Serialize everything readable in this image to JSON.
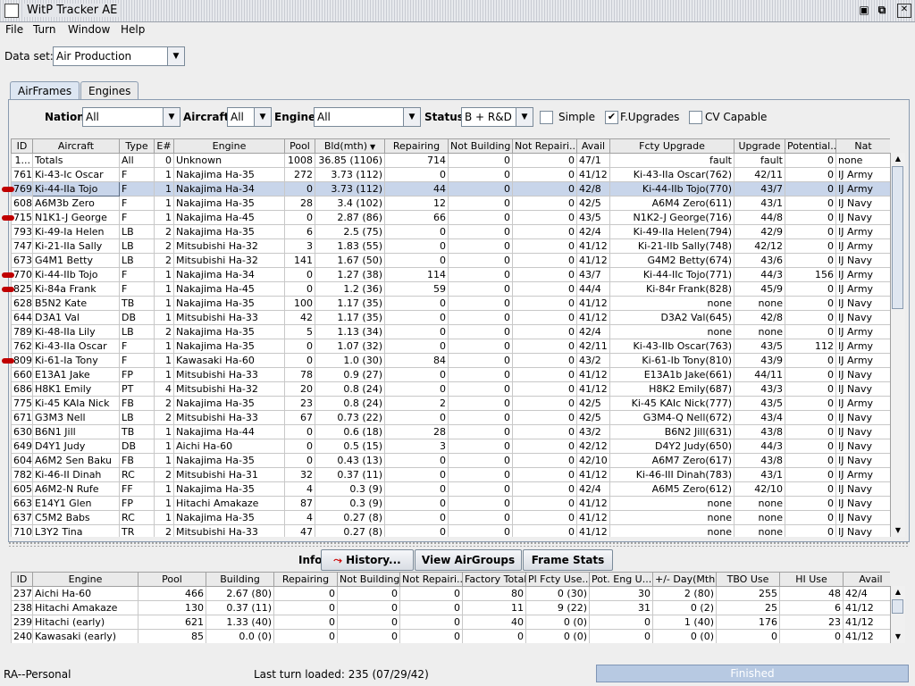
{
  "window": {
    "title": "WitP Tracker AE"
  },
  "menu": [
    "File",
    "Turn",
    "Window",
    "Help"
  ],
  "dataset": {
    "label": "Data set:",
    "value": "Air Production"
  },
  "tabs": [
    "AirFrames",
    "Engines"
  ],
  "filters": {
    "nation_label": "Nation:",
    "nation_value": "All",
    "aircraft_label": "Aircraft:",
    "aircraft_value": "All",
    "engine_label": "Engine:",
    "engine_value": "All",
    "status_label": "Status:",
    "status_value": "B + R&D",
    "simple_label": "Simple",
    "simple_checked": false,
    "fupgrades_label": "F.Upgrades",
    "fupgrades_checked": true,
    "cv_label": "CV Capable",
    "cv_checked": false
  },
  "airframes": {
    "columns": [
      "ID",
      "Aircraft",
      "Type",
      "E#",
      "Engine",
      "Pool",
      "Bld(mth)",
      "Repairing",
      "Not Building",
      "Not Repairi...",
      "Avail",
      "Fcty Upgrade",
      "Upgrade",
      "Potential...",
      "Nat"
    ],
    "sort_indicator": "▼",
    "selected_row": 2,
    "rows": [
      [
        "1...",
        "Totals",
        "All",
        "0",
        "Unknown",
        "1008",
        "36.85 (1106)",
        "714",
        "0",
        "0",
        "47/1",
        "fault",
        "fault",
        "0",
        "none"
      ],
      [
        "761",
        "Ki-43-Ic Oscar",
        "F",
        "1",
        "Nakajima Ha-35",
        "272",
        "3.73 (112)",
        "0",
        "0",
        "0",
        "41/12",
        "Ki-43-IIa Oscar(762)",
        "42/11",
        "0",
        "IJ Army"
      ],
      [
        "769",
        "Ki-44-IIa Tojo",
        "F",
        "1",
        "Nakajima Ha-34",
        "0",
        "3.73 (112)",
        "44",
        "0",
        "0",
        "42/8",
        "Ki-44-IIb Tojo(770)",
        "43/7",
        "0",
        "IJ Army"
      ],
      [
        "608",
        "A6M3b Zero",
        "F",
        "1",
        "Nakajima Ha-35",
        "28",
        "3.4 (102)",
        "12",
        "0",
        "0",
        "42/5",
        "A6M4 Zero(611)",
        "43/1",
        "0",
        "IJ Navy"
      ],
      [
        "715",
        "N1K1-J George",
        "F",
        "1",
        "Nakajima Ha-45",
        "0",
        "2.87 (86)",
        "66",
        "0",
        "0",
        "43/5",
        "N1K2-J George(716)",
        "44/8",
        "0",
        "IJ Navy"
      ],
      [
        "793",
        "Ki-49-Ia Helen",
        "LB",
        "2",
        "Nakajima Ha-35",
        "6",
        "2.5 (75)",
        "0",
        "0",
        "0",
        "42/4",
        "Ki-49-IIa Helen(794)",
        "42/9",
        "0",
        "IJ Army"
      ],
      [
        "747",
        "Ki-21-IIa Sally",
        "LB",
        "2",
        "Mitsubishi Ha-32",
        "3",
        "1.83 (55)",
        "0",
        "0",
        "0",
        "41/12",
        "Ki-21-IIb Sally(748)",
        "42/12",
        "0",
        "IJ Army"
      ],
      [
        "673",
        "G4M1 Betty",
        "LB",
        "2",
        "Mitsubishi Ha-32",
        "141",
        "1.67 (50)",
        "0",
        "0",
        "0",
        "41/12",
        "G4M2 Betty(674)",
        "43/6",
        "0",
        "IJ Navy"
      ],
      [
        "770",
        "Ki-44-IIb Tojo",
        "F",
        "1",
        "Nakajima Ha-34",
        "0",
        "1.27 (38)",
        "114",
        "0",
        "0",
        "43/7",
        "Ki-44-IIc Tojo(771)",
        "44/3",
        "156",
        "IJ Army"
      ],
      [
        "825",
        "Ki-84a Frank",
        "F",
        "1",
        "Nakajima Ha-45",
        "0",
        "1.2 (36)",
        "59",
        "0",
        "0",
        "44/4",
        "Ki-84r Frank(828)",
        "45/9",
        "0",
        "IJ Army"
      ],
      [
        "628",
        "B5N2 Kate",
        "TB",
        "1",
        "Nakajima Ha-35",
        "100",
        "1.17 (35)",
        "0",
        "0",
        "0",
        "41/12",
        "none",
        "none",
        "0",
        "IJ Navy"
      ],
      [
        "644",
        "D3A1 Val",
        "DB",
        "1",
        "Mitsubishi Ha-33",
        "42",
        "1.17 (35)",
        "0",
        "0",
        "0",
        "41/12",
        "D3A2 Val(645)",
        "42/8",
        "0",
        "IJ Navy"
      ],
      [
        "789",
        "Ki-48-IIa Lily",
        "LB",
        "2",
        "Nakajima Ha-35",
        "5",
        "1.13 (34)",
        "0",
        "0",
        "0",
        "42/4",
        "none",
        "none",
        "0",
        "IJ Army"
      ],
      [
        "762",
        "Ki-43-IIa Oscar",
        "F",
        "1",
        "Nakajima Ha-35",
        "0",
        "1.07 (32)",
        "0",
        "0",
        "0",
        "42/11",
        "Ki-43-IIb Oscar(763)",
        "43/5",
        "112",
        "IJ Army"
      ],
      [
        "809",
        "Ki-61-Ia Tony",
        "F",
        "1",
        "Kawasaki Ha-60",
        "0",
        "1.0 (30)",
        "84",
        "0",
        "0",
        "43/2",
        "Ki-61-Ib Tony(810)",
        "43/9",
        "0",
        "IJ Army"
      ],
      [
        "660",
        "E13A1 Jake",
        "FP",
        "1",
        "Mitsubishi Ha-33",
        "78",
        "0.9 (27)",
        "0",
        "0",
        "0",
        "41/12",
        "E13A1b Jake(661)",
        "44/11",
        "0",
        "IJ Navy"
      ],
      [
        "686",
        "H8K1 Emily",
        "PT",
        "4",
        "Mitsubishi Ha-32",
        "20",
        "0.8 (24)",
        "0",
        "0",
        "0",
        "41/12",
        "H8K2 Emily(687)",
        "43/3",
        "0",
        "IJ Navy"
      ],
      [
        "775",
        "Ki-45 KAIa Nick",
        "FB",
        "2",
        "Nakajima Ha-35",
        "23",
        "0.8 (24)",
        "2",
        "0",
        "0",
        "42/5",
        "Ki-45 KAIc Nick(777)",
        "43/5",
        "0",
        "IJ Army"
      ],
      [
        "671",
        "G3M3 Nell",
        "LB",
        "2",
        "Mitsubishi Ha-33",
        "67",
        "0.73 (22)",
        "0",
        "0",
        "0",
        "42/5",
        "G3M4-Q Nell(672)",
        "43/4",
        "0",
        "IJ Navy"
      ],
      [
        "630",
        "B6N1 Jill",
        "TB",
        "1",
        "Nakajima Ha-44",
        "0",
        "0.6 (18)",
        "28",
        "0",
        "0",
        "43/2",
        "B6N2 Jill(631)",
        "43/8",
        "0",
        "IJ Navy"
      ],
      [
        "649",
        "D4Y1 Judy",
        "DB",
        "1",
        "Aichi Ha-60",
        "0",
        "0.5 (15)",
        "3",
        "0",
        "0",
        "42/12",
        "D4Y2 Judy(650)",
        "44/3",
        "0",
        "IJ Navy"
      ],
      [
        "604",
        "A6M2 Sen Baku",
        "FB",
        "1",
        "Nakajima Ha-35",
        "0",
        "0.43 (13)",
        "0",
        "0",
        "0",
        "42/10",
        "A6M7 Zero(617)",
        "43/8",
        "0",
        "IJ Navy"
      ],
      [
        "782",
        "Ki-46-II Dinah",
        "RC",
        "2",
        "Mitsubishi Ha-31",
        "32",
        "0.37 (11)",
        "0",
        "0",
        "0",
        "41/12",
        "Ki-46-III Dinah(783)",
        "43/1",
        "0",
        "IJ Army"
      ],
      [
        "605",
        "A6M2-N Rufe",
        "FF",
        "1",
        "Nakajima Ha-35",
        "4",
        "0.3 (9)",
        "0",
        "0",
        "0",
        "42/4",
        "A6M5 Zero(612)",
        "42/10",
        "0",
        "IJ Navy"
      ],
      [
        "663",
        "E14Y1 Glen",
        "FP",
        "1",
        "Hitachi Amakaze",
        "87",
        "0.3 (9)",
        "0",
        "0",
        "0",
        "41/12",
        "none",
        "none",
        "0",
        "IJ Navy"
      ],
      [
        "637",
        "C5M2 Babs",
        "RC",
        "1",
        "Nakajima Ha-35",
        "4",
        "0.27 (8)",
        "0",
        "0",
        "0",
        "41/12",
        "none",
        "none",
        "0",
        "IJ Navy"
      ],
      [
        "710",
        "L3Y2 Tina",
        "TR",
        "2",
        "Mitsubishi Ha-33",
        "47",
        "0.27 (8)",
        "0",
        "0",
        "0",
        "41/12",
        "none",
        "none",
        "0",
        "IJ Navy"
      ]
    ]
  },
  "info": {
    "label": "Info:",
    "history_button": "History...",
    "airgroups_button": "View AirGroups",
    "framestats_button": "Frame Stats"
  },
  "engines": {
    "columns": [
      "ID",
      "Engine",
      "Pool",
      "Building",
      "Repairing",
      "Not Building",
      "Not Repairi...",
      "Factory Total",
      "Pl Fcty Use...",
      "Pot. Eng U...",
      "+/- Day(Mth)",
      "TBO Use",
      "HI Use",
      "Avail"
    ],
    "rows": [
      [
        "237",
        "Aichi Ha-60",
        "466",
        "2.67 (80)",
        "0",
        "0",
        "0",
        "80",
        "0 (30)",
        "30",
        "2 (80)",
        "255",
        "48",
        "42/4"
      ],
      [
        "238",
        "Hitachi Amakaze",
        "130",
        "0.37 (11)",
        "0",
        "0",
        "0",
        "11",
        "9 (22)",
        "31",
        "0 (2)",
        "25",
        "6",
        "41/12"
      ],
      [
        "239",
        "Hitachi (early)",
        "621",
        "1.33 (40)",
        "0",
        "0",
        "0",
        "40",
        "0 (0)",
        "0",
        "1 (40)",
        "176",
        "23",
        "41/12"
      ],
      [
        "240",
        "Kawasaki (early)",
        "85",
        "0.0 (0)",
        "0",
        "0",
        "0",
        "0",
        "0 (0)",
        "0",
        "0 (0)",
        "0",
        "0",
        "41/12"
      ]
    ]
  },
  "status": {
    "left": "RA--Personal",
    "center": "Last turn loaded: 235 (07/29/42)",
    "progress_text": "Finished",
    "progress_fraction": 1.0
  }
}
